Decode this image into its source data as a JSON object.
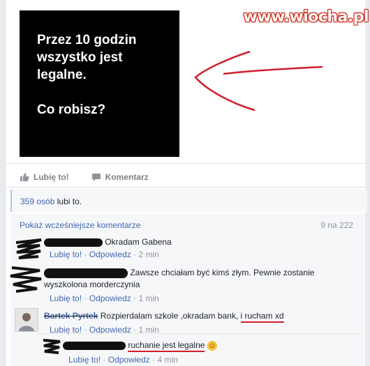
{
  "watermark": "www.wiocha.pl",
  "post": {
    "lines": [
      "Przez 10 godzin",
      "wszystko jest",
      "legalne.",
      "",
      "Co robisz?"
    ]
  },
  "actions": {
    "like": "Lubię to!",
    "comment": "Komentarz"
  },
  "likes": {
    "count": "359 osób",
    "rest": " lubi to."
  },
  "comments_header": {
    "show_previous": "Pokaż wcześniejsze komentarze",
    "count": "9 na 222"
  },
  "comments": [
    {
      "text": "Okradam Gabena",
      "like": "Lubię to!",
      "reply": "Odpowiedz",
      "time": "2 min"
    },
    {
      "text": "Zawsze chciałam być kimś złym. Pewnie zostanie",
      "text2": "wyszkolona morderczynia",
      "like": "Lubię to!",
      "reply": "Odpowiedz",
      "time": "1 min"
    },
    {
      "author": "Bartek Pyrtek",
      "text": "Rozpierdalam szkole ,okradam bank, ",
      "text_hl": "i rucham xd",
      "like": "Lubię to!",
      "reply": "Odpowiedz",
      "time": "1 min"
    },
    {
      "text_hl": "ruchanie jest legalne",
      "emoji": "☺",
      "like": "Lubię to!",
      "reply": "Odpowiedz",
      "time": "4 min"
    }
  ],
  "colors": {
    "link": "#4267b2",
    "meta": "#90949c",
    "annotation": "#d01f2a"
  }
}
